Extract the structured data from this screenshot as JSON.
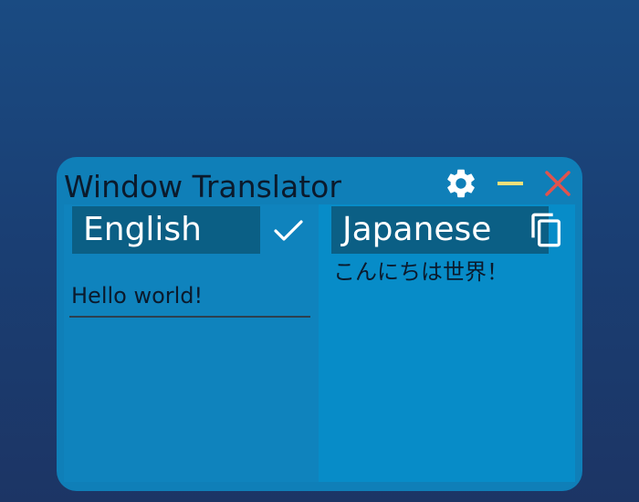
{
  "window": {
    "title": "Window Translator",
    "controls": {
      "settings_icon": "gear-icon",
      "minimize_icon": "minimize-icon",
      "close_icon": "close-icon"
    }
  },
  "source": {
    "language": "English",
    "confirm_icon": "checkmark-icon",
    "input_value": "Hello world!"
  },
  "target": {
    "language": "Japanese",
    "copy_icon": "copy-icon",
    "output_text": "こんにちは世界！"
  },
  "colors": {
    "desktop": "#1a3f74",
    "window": "#0f7fb8",
    "lang_bar": "#0b5f85",
    "minimize_accent": "#f2e07a",
    "close_accent": "#e0534e",
    "text_dark": "#0b1a2c"
  }
}
